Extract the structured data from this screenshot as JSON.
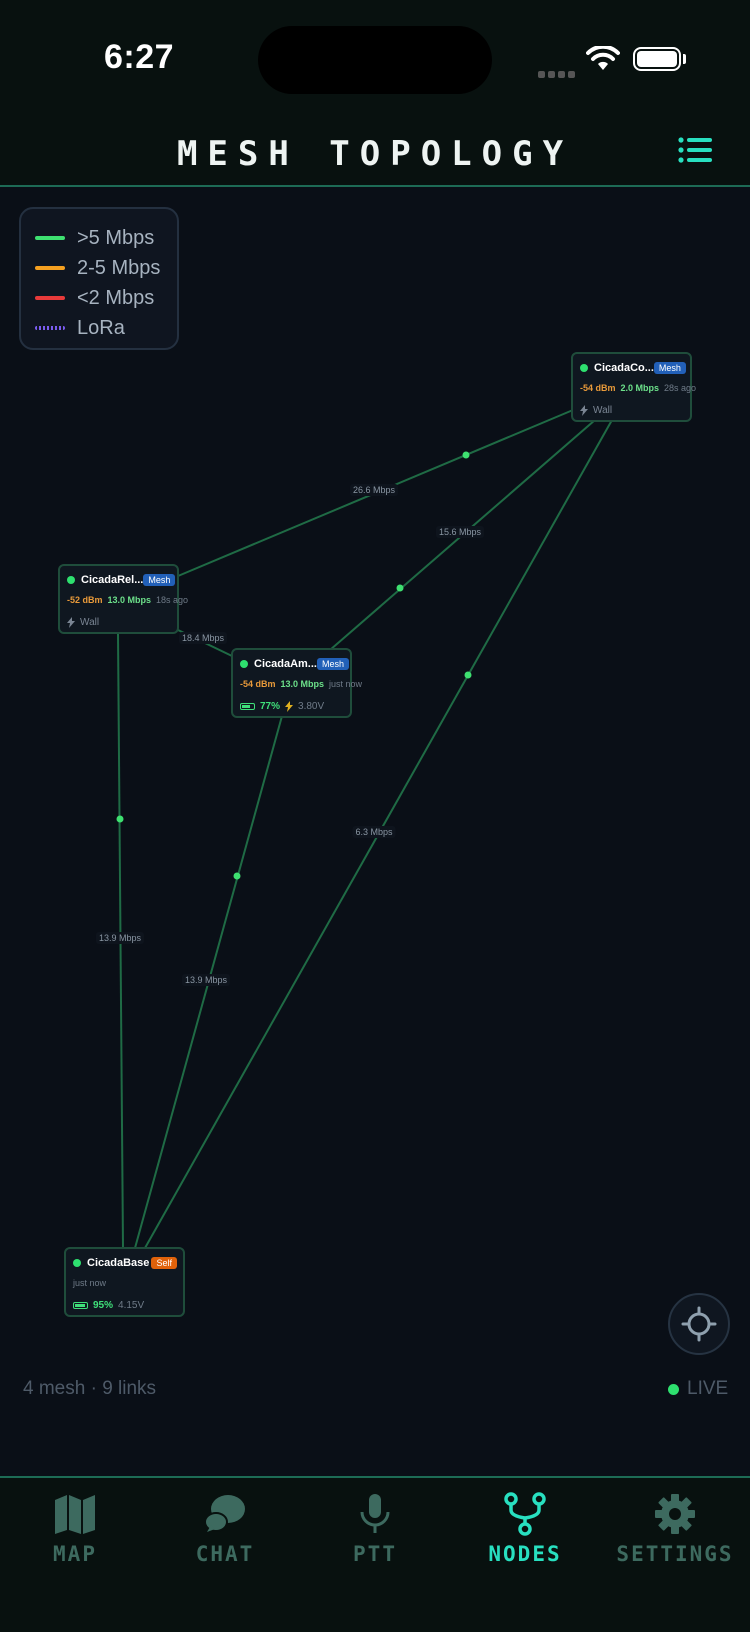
{
  "status_bar": {
    "time": "6:27"
  },
  "header": {
    "title": "MESH TOPOLOGY"
  },
  "legend": [
    {
      "label": ">5 Mbps",
      "color": "#3ee070"
    },
    {
      "label": "2-5 Mbps",
      "color": "#f5a020"
    },
    {
      "label": "<2 Mbps",
      "color": "#e83a3a"
    },
    {
      "label": "LoRa",
      "color": "#7a5cf0"
    }
  ],
  "nodes": {
    "cicada_co": {
      "name": "CicadaCo...",
      "badge": "Mesh",
      "rssi": "-54 dBm",
      "rate": "2.0 Mbps",
      "ago": "28s ago",
      "power": "Wall"
    },
    "cicada_rel": {
      "name": "CicadaRel...",
      "badge": "Mesh",
      "rssi": "-52 dBm",
      "rate": "13.0 Mbps",
      "ago": "18s ago",
      "power": "Wall"
    },
    "cicada_am": {
      "name": "CicadaAm...",
      "badge": "Mesh",
      "rssi": "-54 dBm",
      "rate": "13.0 Mbps",
      "ago": "just now",
      "battery": "77%",
      "battery_level": 0.77,
      "voltage": "3.80V"
    },
    "cicada_base": {
      "name": "CicadaBase",
      "badge": "Self",
      "ago": "just now",
      "battery": "95%",
      "battery_level": 0.95,
      "voltage": "4.15V"
    }
  },
  "links": [
    {
      "label": "26.6 Mbps"
    },
    {
      "label": "15.6 Mbps"
    },
    {
      "label": "6.3 Mbps"
    },
    {
      "label": "18.4 Mbps"
    },
    {
      "label": "13.9 Mbps"
    },
    {
      "label": "13.9 Mbps"
    }
  ],
  "footer": {
    "summary": "4 mesh · 9 links",
    "live": "LIVE"
  },
  "tabs": [
    {
      "label": "MAP",
      "icon": "map-icon"
    },
    {
      "label": "CHAT",
      "icon": "chat-icon"
    },
    {
      "label": "PTT",
      "icon": "microphone-icon"
    },
    {
      "label": "NODES",
      "icon": "nodes-icon",
      "active": true
    },
    {
      "label": "SETTINGS",
      "icon": "gear-icon"
    }
  ],
  "colors": {
    "accent": "#28e0c0",
    "link": "#1f6b45",
    "link_dot": "#3ee070"
  }
}
